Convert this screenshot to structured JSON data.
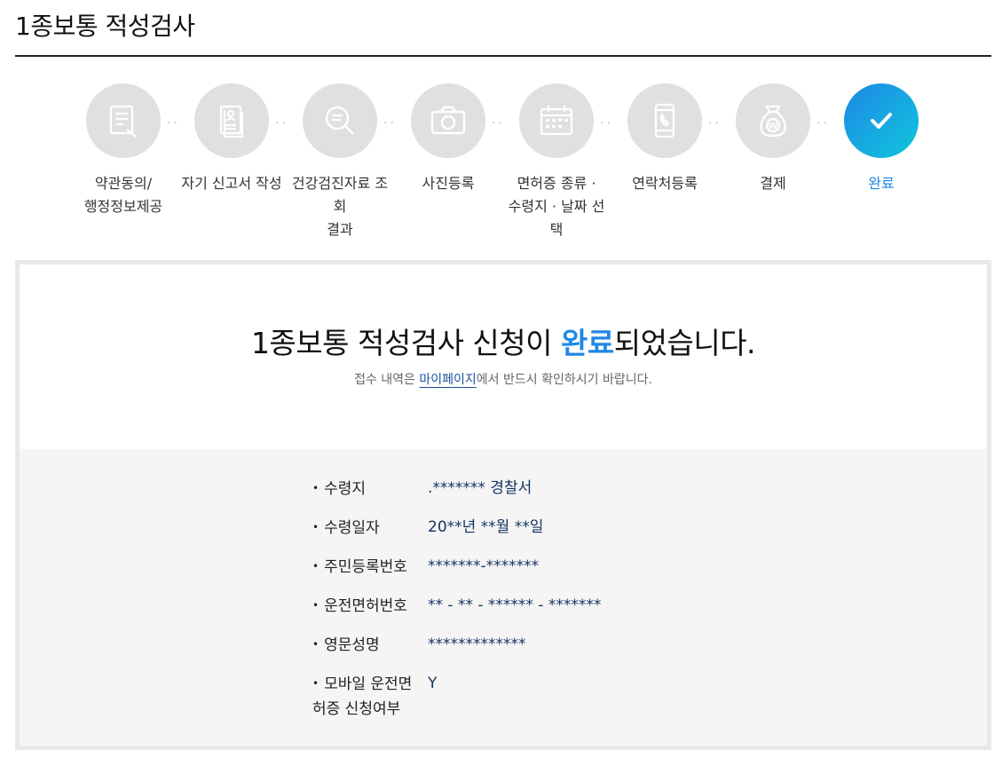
{
  "page": {
    "title": "1종보통 적성검사"
  },
  "steps": [
    {
      "label": "약관동의/\n행정정보제공",
      "icon": "document-edit-icon",
      "active": false
    },
    {
      "label": "자기 신고서 작성",
      "icon": "profile-document-icon",
      "active": false
    },
    {
      "label": "건강검진자료 조회\n결과",
      "icon": "search-document-icon",
      "active": false
    },
    {
      "label": "사진등록",
      "icon": "camera-icon",
      "active": false
    },
    {
      "label": "면허증 종류 ·\n수령지 · 날짜 선택",
      "icon": "calendar-icon",
      "active": false
    },
    {
      "label": "연락처등록",
      "icon": "phone-icon",
      "active": false
    },
    {
      "label": "결제",
      "icon": "money-bag-icon",
      "active": false
    },
    {
      "label": "완료",
      "icon": "check-icon",
      "active": true
    }
  ],
  "result": {
    "headline_prefix": "1종보통 적성검사 신청이 ",
    "headline_highlight": "완료",
    "headline_suffix": "되었습니다.",
    "sub_prefix": "접수 내역은 ",
    "sub_link": "마이페이지",
    "sub_suffix": "에서 반드시 확인하시기 바랍니다."
  },
  "details": [
    {
      "label": "수령지",
      "value": ".******* 경찰서"
    },
    {
      "label": "수령일자",
      "value": "20**년 **월 **일"
    },
    {
      "label": "주민등록번호",
      "value": "*******-*******"
    },
    {
      "label": "운전면허번호",
      "value": "** - ** - ****** - *******"
    },
    {
      "label": "영문성명",
      "value": "*************"
    },
    {
      "label": "모바일 운전면허증 신청여부",
      "value": "Y"
    }
  ],
  "colors": {
    "accent": "#1e88e5",
    "inactive_step": "#e0e0e0",
    "panel_border": "#e9e9e9",
    "panel_bottom_bg": "#f5f5f5"
  }
}
